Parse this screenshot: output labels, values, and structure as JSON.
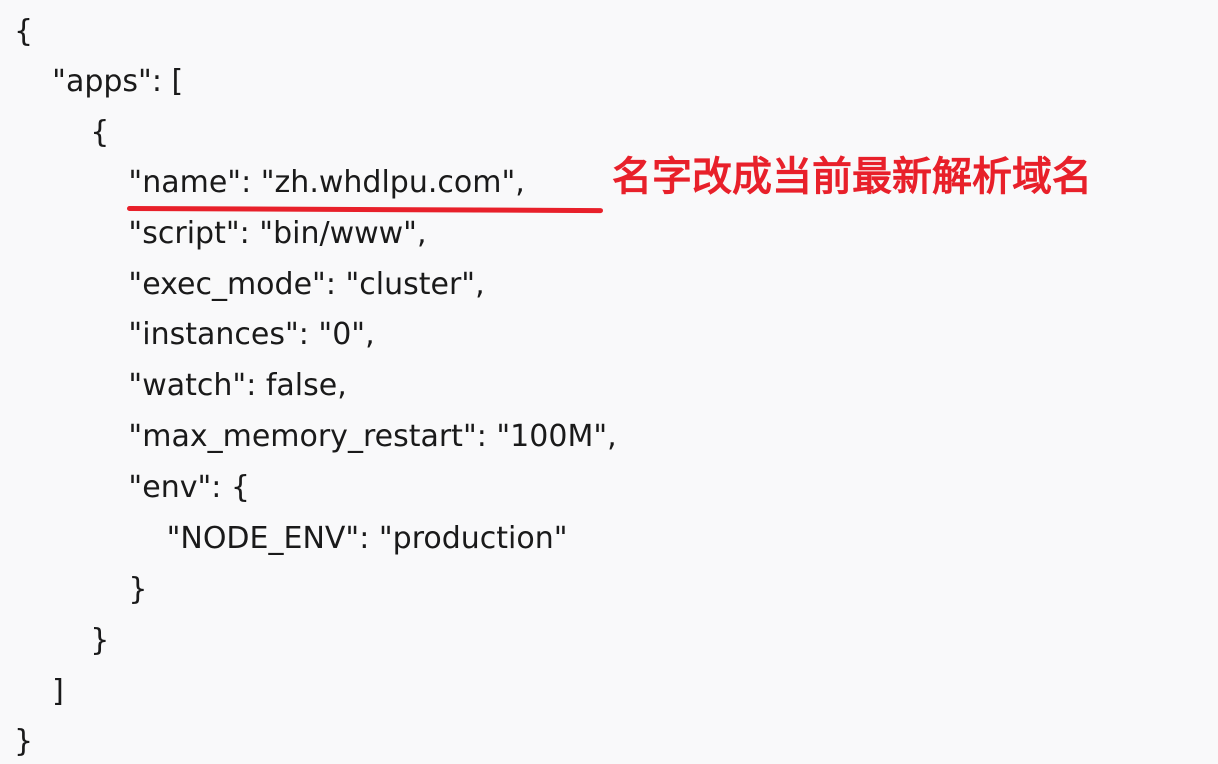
{
  "document": {
    "lines": [
      "{",
      "    \"apps\": [",
      "        {",
      "            \"name\": \"zh.whdlpu.com\",",
      "            \"script\": \"bin/www\",",
      "            \"exec_mode\": \"cluster\",",
      "            \"instances\": \"0\",",
      "            \"watch\": false,",
      "            \"max_memory_restart\": \"100M\",",
      "            \"env\": {",
      "                \"NODE_ENV\": \"production\"",
      "            }",
      "        }",
      "    ]",
      "}"
    ]
  },
  "annotation": {
    "note": "名字改成当前最新解析域名",
    "color": "#e8202a"
  }
}
